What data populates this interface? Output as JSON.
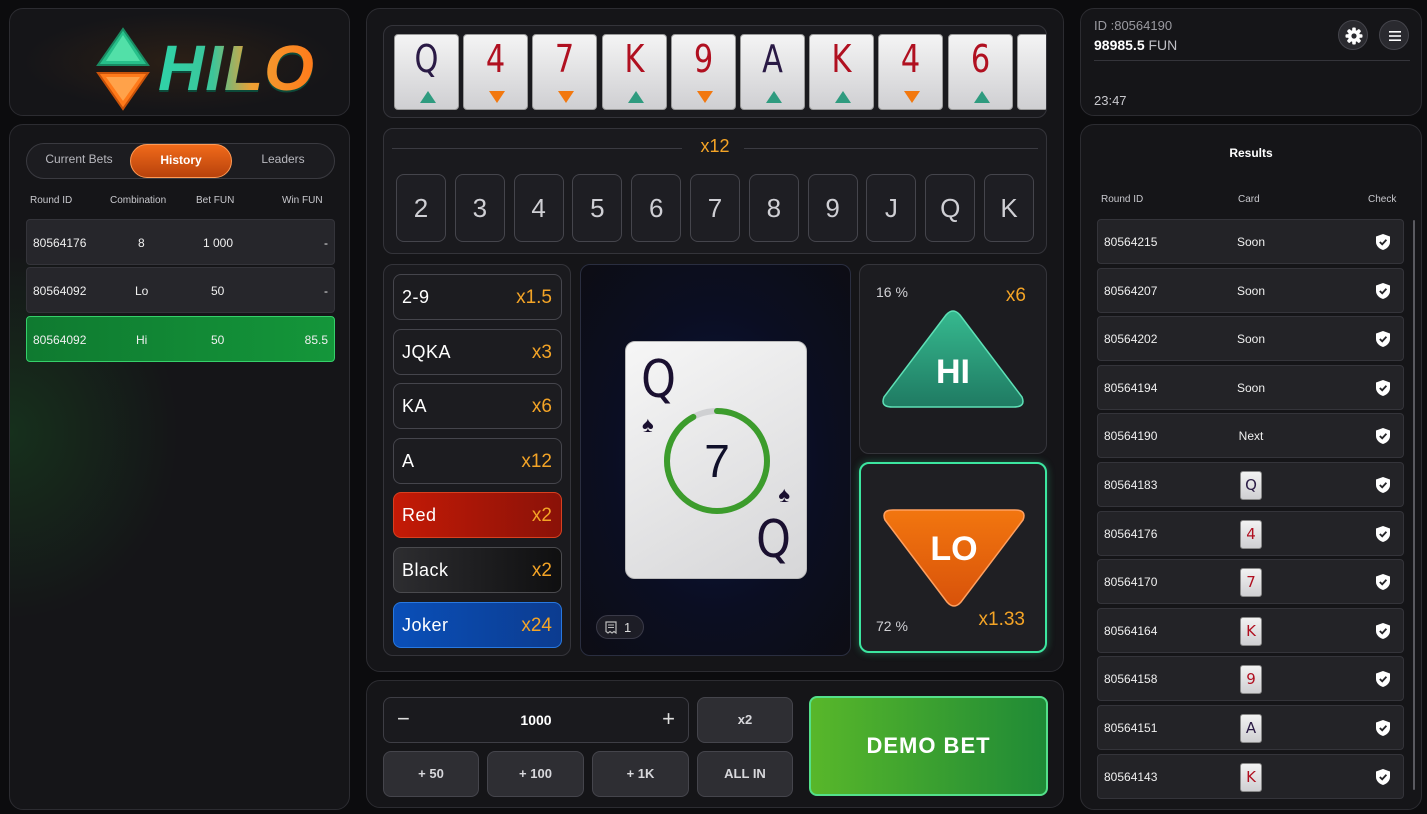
{
  "logo": {
    "text": "HILO"
  },
  "tabs": [
    {
      "label": "Current Bets",
      "active": false
    },
    {
      "label": "History",
      "active": true
    },
    {
      "label": "Leaders",
      "active": false
    }
  ],
  "history": {
    "columns": [
      "Round ID",
      "Combination",
      "Bet  FUN",
      "Win  FUN"
    ],
    "rows": [
      {
        "round": "80564176",
        "combo": "8",
        "bet": "1 000",
        "win": "-",
        "won": false
      },
      {
        "round": "80564092",
        "combo": "Lo",
        "bet": "50",
        "win": "-",
        "won": false
      },
      {
        "round": "80564092",
        "combo": "Hi",
        "bet": "50",
        "win": "85.5",
        "won": true
      }
    ]
  },
  "card_strip": [
    {
      "rank": "Q",
      "color": "#2a1a45",
      "dir": "up"
    },
    {
      "rank": "4",
      "color": "#b01020",
      "dir": "down"
    },
    {
      "rank": "7",
      "color": "#b01020",
      "dir": "down"
    },
    {
      "rank": "K",
      "color": "#b01020",
      "dir": "up"
    },
    {
      "rank": "9",
      "color": "#b01020",
      "dir": "down"
    },
    {
      "rank": "A",
      "color": "#2a1a45",
      "dir": "up"
    },
    {
      "rank": "K",
      "color": "#b01020",
      "dir": "up"
    },
    {
      "rank": "4",
      "color": "#b01020",
      "dir": "down"
    },
    {
      "rank": "6",
      "color": "#b01020",
      "dir": "up"
    }
  ],
  "rank_bet": {
    "multiplier": "x12",
    "ranks": [
      "2",
      "3",
      "4",
      "5",
      "6",
      "7",
      "8",
      "9",
      "J",
      "Q",
      "K"
    ]
  },
  "options": [
    {
      "label": "2-9",
      "mult": "x1.5",
      "style": "plain"
    },
    {
      "label": "JQKA",
      "mult": "x3",
      "style": "plain"
    },
    {
      "label": "KA",
      "mult": "x6",
      "style": "plain"
    },
    {
      "label": "A",
      "mult": "x12",
      "style": "plain"
    },
    {
      "label": "Red",
      "mult": "x2",
      "style": "red"
    },
    {
      "label": "Black",
      "mult": "x2",
      "style": "black"
    },
    {
      "label": "Joker",
      "mult": "x24",
      "style": "joker"
    }
  ],
  "current_card": {
    "rank": "Q",
    "suit": "♠",
    "timer": "7",
    "timer_progress": 0.92,
    "counter": "1"
  },
  "hi": {
    "label": "HI",
    "percent": "16 %",
    "mult": "x6"
  },
  "lo": {
    "label": "LO",
    "percent": "72 %",
    "mult": "x1.33"
  },
  "bet": {
    "amount": "1000",
    "minus": "−",
    "plus": "+",
    "double": "x2",
    "quick": [
      "+ 50",
      "+ 100",
      "+ 1K"
    ],
    "all_in": "ALL IN",
    "demo_bet": "DEMO BET"
  },
  "account": {
    "id": "ID :80564190",
    "balance": "98985.5",
    "currency": "FUN",
    "time": "23:47"
  },
  "results": {
    "title": "Results",
    "columns": [
      "Round ID",
      "Card",
      "Check"
    ],
    "rows": [
      {
        "round": "80564215",
        "card": "Soon",
        "type": "text"
      },
      {
        "round": "80564207",
        "card": "Soon",
        "type": "text"
      },
      {
        "round": "80564202",
        "card": "Soon",
        "type": "text"
      },
      {
        "round": "80564194",
        "card": "Soon",
        "type": "text"
      },
      {
        "round": "80564190",
        "card": "Next",
        "type": "text"
      },
      {
        "round": "80564183",
        "card": "Q",
        "type": "card",
        "color": "#2a1a45"
      },
      {
        "round": "80564176",
        "card": "4",
        "type": "card",
        "color": "#b01020"
      },
      {
        "round": "80564170",
        "card": "7",
        "type": "card",
        "color": "#b01020"
      },
      {
        "round": "80564164",
        "card": "K",
        "type": "card",
        "color": "#b01020"
      },
      {
        "round": "80564158",
        "card": "9",
        "type": "card",
        "color": "#b01020"
      },
      {
        "round": "80564151",
        "card": "A",
        "type": "card",
        "color": "#2a1a45"
      },
      {
        "round": "80564143",
        "card": "K",
        "type": "card",
        "color": "#b01020"
      }
    ]
  },
  "colors": {
    "accent_orange": "#f4a426",
    "hi_green": "#2f9b7f",
    "lo_orange": "#f2780f",
    "win_green": "#14963a"
  }
}
